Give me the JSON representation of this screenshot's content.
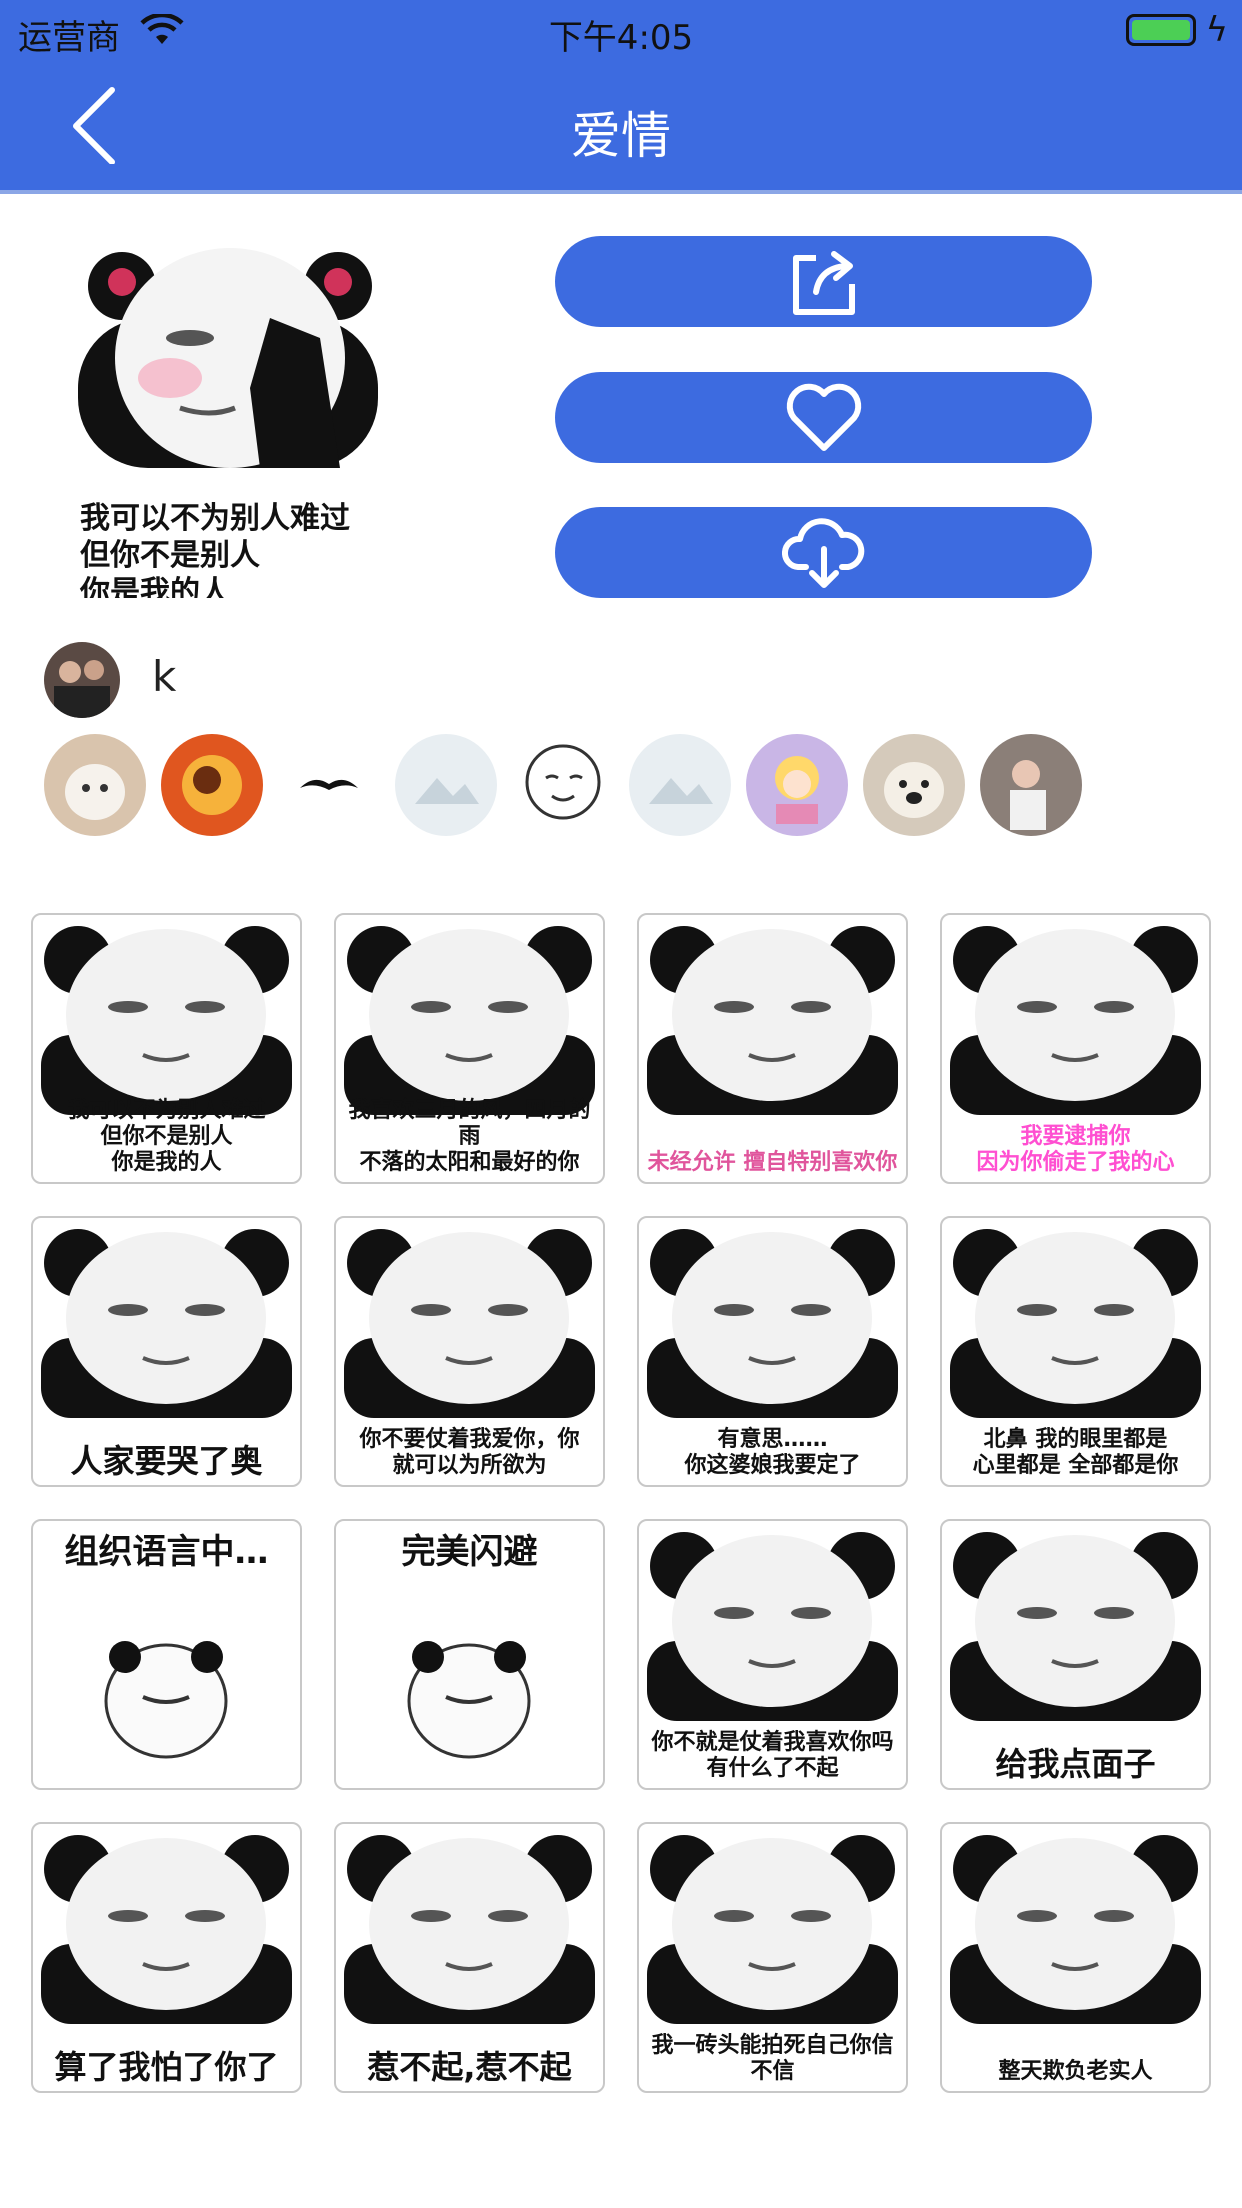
{
  "status_bar": {
    "carrier": "运营商",
    "time": "下午4:05"
  },
  "nav": {
    "title": "爱情"
  },
  "preview": {
    "caption_lines": [
      "我可以不为别人难过",
      "但你不是别人",
      "你是我的人"
    ]
  },
  "actions": [
    {
      "name": "share",
      "icon": "share-icon"
    },
    {
      "name": "like",
      "icon": "heart-icon"
    },
    {
      "name": "download",
      "icon": "cloud-download-icon"
    }
  ],
  "author": {
    "name": "k"
  },
  "likers_count": 9,
  "grid": [
    {
      "caption": "我可以不为别人难过\n但你不是别人\n你是我的人",
      "style": "left"
    },
    {
      "caption": "我喜欢三月的风，四月的雨\n不落的太阳和最好的你",
      "style": ""
    },
    {
      "caption": "未经允许 擅自特别喜欢你",
      "style": "pink"
    },
    {
      "caption": "我要逮捕你\n因为你偷走了我的心",
      "style": "magenta"
    },
    {
      "caption": "人家要哭了奥",
      "style": "big"
    },
    {
      "caption": "你不要仗着我爱你，你\n就可以为所欲为",
      "style": ""
    },
    {
      "caption": "有意思……\n你这婆娘我要定了",
      "style": ""
    },
    {
      "caption": "北鼻 我的眼里都是\n心里都是 全部都是你",
      "style": ""
    },
    {
      "caption": "组织语言中…",
      "style": "top"
    },
    {
      "caption": "完美闪避",
      "style": "top"
    },
    {
      "caption": "你不就是仗着我喜欢你吗\n有什么了不起",
      "style": ""
    },
    {
      "caption": "给我点面子",
      "style": "big"
    },
    {
      "caption": "算了我怕了你了",
      "style": "big"
    },
    {
      "caption": "惹不起,惹不起",
      "style": "big"
    },
    {
      "caption": "我一砖头能拍死自己你信\n不信",
      "style": ""
    },
    {
      "caption": "整天欺负老实人",
      "style": ""
    }
  ],
  "colors": {
    "primary": "#3d6be0",
    "battery": "#4ccf55"
  }
}
